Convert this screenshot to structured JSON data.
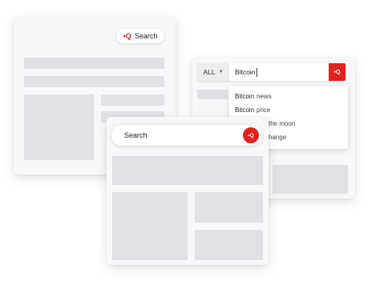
{
  "card_back_left": {
    "search_pill": {
      "icon": "red-plus-search-icon",
      "icon_glyph": "•Q",
      "label": "Search"
    }
  },
  "card_right": {
    "category_select": {
      "value": "ALL",
      "chevron": "▼"
    },
    "search_input": {
      "value": "Bitcoin"
    },
    "search_button": {
      "icon": "red-plus-search-icon",
      "icon_glyph": "•Q"
    },
    "suggestions": [
      {
        "prefix": "Bitcoin",
        "suffix": "news"
      },
      {
        "prefix": "Bitcoin",
        "suffix": "price"
      },
      {
        "prefix": "",
        "suffix": "the moon"
      },
      {
        "prefix": "",
        "suffix": "hange"
      }
    ]
  },
  "card_front": {
    "search_label": "Search",
    "search_button": {
      "icon": "red-plus-search-icon",
      "icon_glyph": "•Q"
    }
  },
  "colors": {
    "accent": "#e0231c",
    "placeholder_block": "#e2e2e6",
    "card_bg": "#f7f7f9"
  }
}
